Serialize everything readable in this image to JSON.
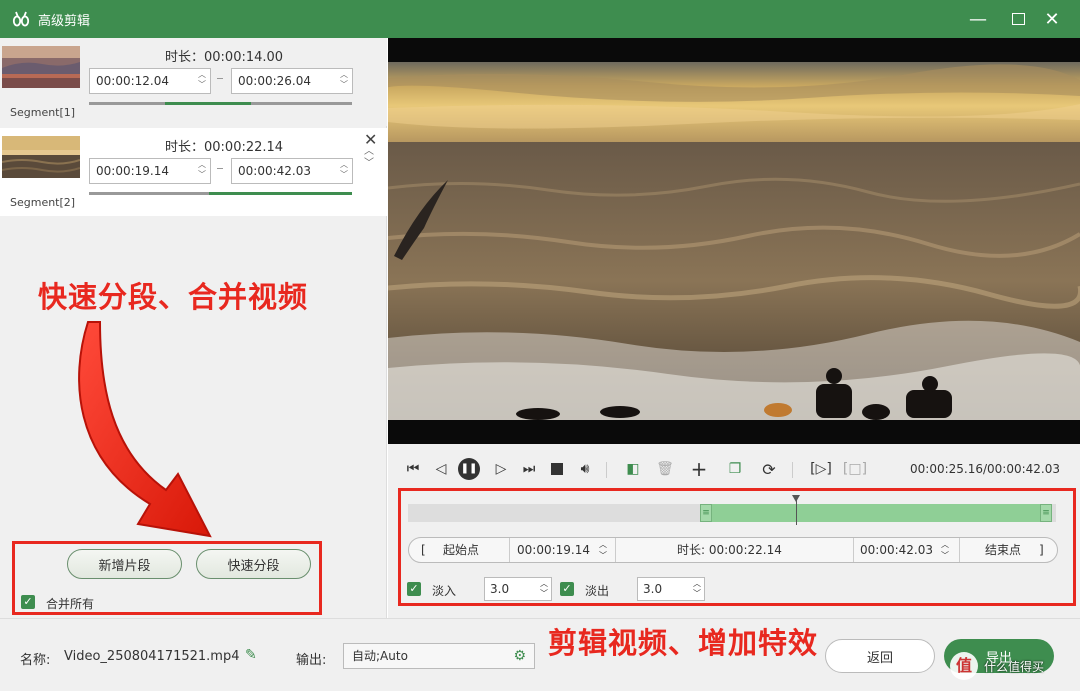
{
  "window": {
    "title": "高级剪辑"
  },
  "segments": [
    {
      "label": "Segment[1]",
      "duration_label": "时长：00:00:14.00",
      "start": "00:00:12.04",
      "end": "00:00:26.04"
    },
    {
      "label": "Segment[2]",
      "duration_label": "时长：00:00:22.14",
      "start": "00:00:19.14",
      "end": "00:00:42.03"
    }
  ],
  "annotations": {
    "left": "快速分段、合并视频",
    "right": "剪辑视频、增加特效"
  },
  "left_buttons": {
    "add_segment": "新增片段",
    "fast_split": "快速分段",
    "merge_all": "合并所有"
  },
  "player": {
    "timecode": "00:00:25.16/00:00:42.03",
    "progress": 0.599
  },
  "trim": {
    "start_btn": "起始点",
    "start_bracket": "[",
    "start_time": "00:00:19.14",
    "duration": "时长:  00:00:22.14",
    "end_time": "00:00:42.03",
    "end_btn": "结束点",
    "end_bracket": "]",
    "fade_in_label": "淡入",
    "fade_in": "3.0",
    "fade_out_label": "淡出",
    "fade_out": "3.0"
  },
  "bottom": {
    "name_label": "名称:",
    "filename": "Video_250804171521.mp4",
    "output_label": "输出:",
    "output_value": "自动;Auto",
    "back": "返回",
    "export": "导出"
  },
  "watermark": "什么值得买",
  "colors": {
    "brand": "#3e8d4f",
    "annotation": "#e8281f"
  }
}
